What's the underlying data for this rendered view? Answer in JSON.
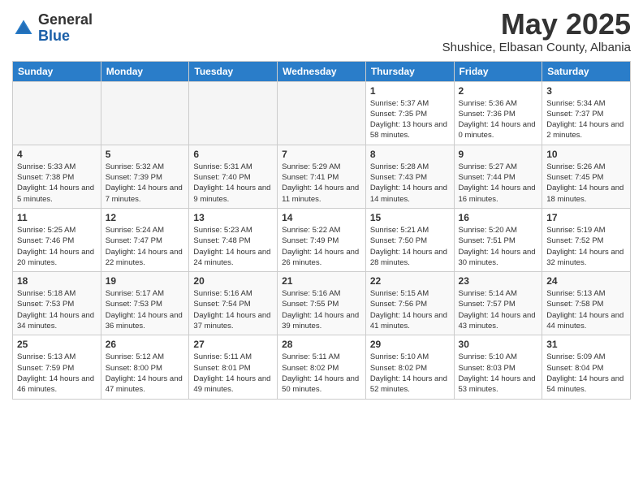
{
  "header": {
    "logo_general": "General",
    "logo_blue": "Blue",
    "month_title": "May 2025",
    "location": "Shushice, Elbasan County, Albania"
  },
  "days_of_week": [
    "Sunday",
    "Monday",
    "Tuesday",
    "Wednesday",
    "Thursday",
    "Friday",
    "Saturday"
  ],
  "weeks": [
    [
      {
        "day": "",
        "empty": true
      },
      {
        "day": "",
        "empty": true
      },
      {
        "day": "",
        "empty": true
      },
      {
        "day": "",
        "empty": true
      },
      {
        "day": "1",
        "sunrise": "5:37 AM",
        "sunset": "7:35 PM",
        "daylight": "13 hours and 58 minutes."
      },
      {
        "day": "2",
        "sunrise": "5:36 AM",
        "sunset": "7:36 PM",
        "daylight": "14 hours and 0 minutes."
      },
      {
        "day": "3",
        "sunrise": "5:34 AM",
        "sunset": "7:37 PM",
        "daylight": "14 hours and 2 minutes."
      }
    ],
    [
      {
        "day": "4",
        "sunrise": "5:33 AM",
        "sunset": "7:38 PM",
        "daylight": "14 hours and 5 minutes."
      },
      {
        "day": "5",
        "sunrise": "5:32 AM",
        "sunset": "7:39 PM",
        "daylight": "14 hours and 7 minutes."
      },
      {
        "day": "6",
        "sunrise": "5:31 AM",
        "sunset": "7:40 PM",
        "daylight": "14 hours and 9 minutes."
      },
      {
        "day": "7",
        "sunrise": "5:29 AM",
        "sunset": "7:41 PM",
        "daylight": "14 hours and 11 minutes."
      },
      {
        "day": "8",
        "sunrise": "5:28 AM",
        "sunset": "7:43 PM",
        "daylight": "14 hours and 14 minutes."
      },
      {
        "day": "9",
        "sunrise": "5:27 AM",
        "sunset": "7:44 PM",
        "daylight": "14 hours and 16 minutes."
      },
      {
        "day": "10",
        "sunrise": "5:26 AM",
        "sunset": "7:45 PM",
        "daylight": "14 hours and 18 minutes."
      }
    ],
    [
      {
        "day": "11",
        "sunrise": "5:25 AM",
        "sunset": "7:46 PM",
        "daylight": "14 hours and 20 minutes."
      },
      {
        "day": "12",
        "sunrise": "5:24 AM",
        "sunset": "7:47 PM",
        "daylight": "14 hours and 22 minutes."
      },
      {
        "day": "13",
        "sunrise": "5:23 AM",
        "sunset": "7:48 PM",
        "daylight": "14 hours and 24 minutes."
      },
      {
        "day": "14",
        "sunrise": "5:22 AM",
        "sunset": "7:49 PM",
        "daylight": "14 hours and 26 minutes."
      },
      {
        "day": "15",
        "sunrise": "5:21 AM",
        "sunset": "7:50 PM",
        "daylight": "14 hours and 28 minutes."
      },
      {
        "day": "16",
        "sunrise": "5:20 AM",
        "sunset": "7:51 PM",
        "daylight": "14 hours and 30 minutes."
      },
      {
        "day": "17",
        "sunrise": "5:19 AM",
        "sunset": "7:52 PM",
        "daylight": "14 hours and 32 minutes."
      }
    ],
    [
      {
        "day": "18",
        "sunrise": "5:18 AM",
        "sunset": "7:53 PM",
        "daylight": "14 hours and 34 minutes."
      },
      {
        "day": "19",
        "sunrise": "5:17 AM",
        "sunset": "7:53 PM",
        "daylight": "14 hours and 36 minutes."
      },
      {
        "day": "20",
        "sunrise": "5:16 AM",
        "sunset": "7:54 PM",
        "daylight": "14 hours and 37 minutes."
      },
      {
        "day": "21",
        "sunrise": "5:16 AM",
        "sunset": "7:55 PM",
        "daylight": "14 hours and 39 minutes."
      },
      {
        "day": "22",
        "sunrise": "5:15 AM",
        "sunset": "7:56 PM",
        "daylight": "14 hours and 41 minutes."
      },
      {
        "day": "23",
        "sunrise": "5:14 AM",
        "sunset": "7:57 PM",
        "daylight": "14 hours and 43 minutes."
      },
      {
        "day": "24",
        "sunrise": "5:13 AM",
        "sunset": "7:58 PM",
        "daylight": "14 hours and 44 minutes."
      }
    ],
    [
      {
        "day": "25",
        "sunrise": "5:13 AM",
        "sunset": "7:59 PM",
        "daylight": "14 hours and 46 minutes."
      },
      {
        "day": "26",
        "sunrise": "5:12 AM",
        "sunset": "8:00 PM",
        "daylight": "14 hours and 47 minutes."
      },
      {
        "day": "27",
        "sunrise": "5:11 AM",
        "sunset": "8:01 PM",
        "daylight": "14 hours and 49 minutes."
      },
      {
        "day": "28",
        "sunrise": "5:11 AM",
        "sunset": "8:02 PM",
        "daylight": "14 hours and 50 minutes."
      },
      {
        "day": "29",
        "sunrise": "5:10 AM",
        "sunset": "8:02 PM",
        "daylight": "14 hours and 52 minutes."
      },
      {
        "day": "30",
        "sunrise": "5:10 AM",
        "sunset": "8:03 PM",
        "daylight": "14 hours and 53 minutes."
      },
      {
        "day": "31",
        "sunrise": "5:09 AM",
        "sunset": "8:04 PM",
        "daylight": "14 hours and 54 minutes."
      }
    ]
  ],
  "labels": {
    "sunrise": "Sunrise: ",
    "sunset": "Sunset: ",
    "daylight": "Daylight: "
  }
}
